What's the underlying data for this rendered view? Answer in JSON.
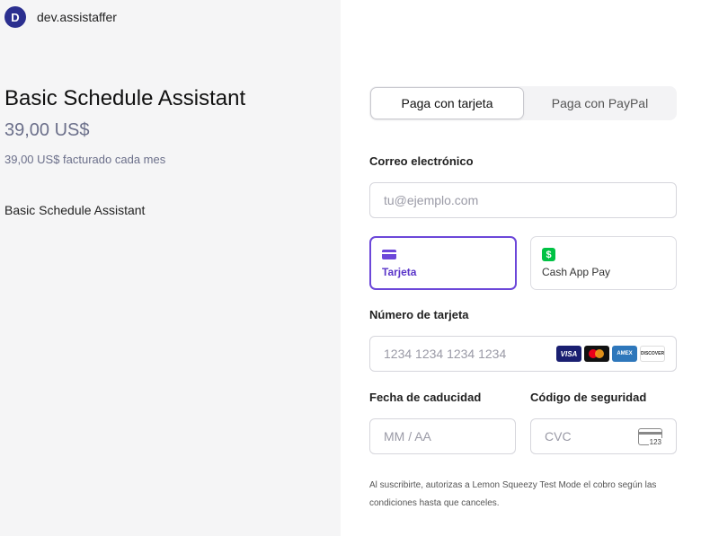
{
  "store": {
    "initial": "D",
    "name": "dev.assistaffer"
  },
  "product": {
    "title": "Basic Schedule Assistant",
    "price": "39,00 US$",
    "billing": "39,00 US$ facturado cada mes",
    "description": "Basic Schedule Assistant"
  },
  "tabs": [
    {
      "label": "Paga con tarjeta",
      "active": true
    },
    {
      "label": "Paga con PayPal",
      "active": false
    }
  ],
  "email": {
    "label": "Correo electrónico",
    "placeholder": "tu@ejemplo.com",
    "value": ""
  },
  "methods": [
    {
      "label": "Tarjeta",
      "icon": "credit-card-icon",
      "selected": true
    },
    {
      "label": "Cash App Pay",
      "icon": "cash-app-icon",
      "selected": false
    }
  ],
  "card": {
    "number_label": "Número de tarjeta",
    "number_placeholder": "1234 1234 1234 1234",
    "brands": [
      "VISA",
      "AMEX",
      "DISCOVER"
    ],
    "expiry_label": "Fecha de caducidad",
    "expiry_placeholder": "MM / AA",
    "cvc_label": "Código de seguridad",
    "cvc_placeholder": "CVC",
    "cvc_icon_text": "123"
  },
  "consent": "Al suscribirte, autorizas a Lemon Squeezy Test Mode el cobro según las condiciones hasta que canceles.",
  "colors": {
    "accent": "#6c47d9",
    "avatar": "#2b2f8f",
    "cash_app": "#00c244"
  }
}
